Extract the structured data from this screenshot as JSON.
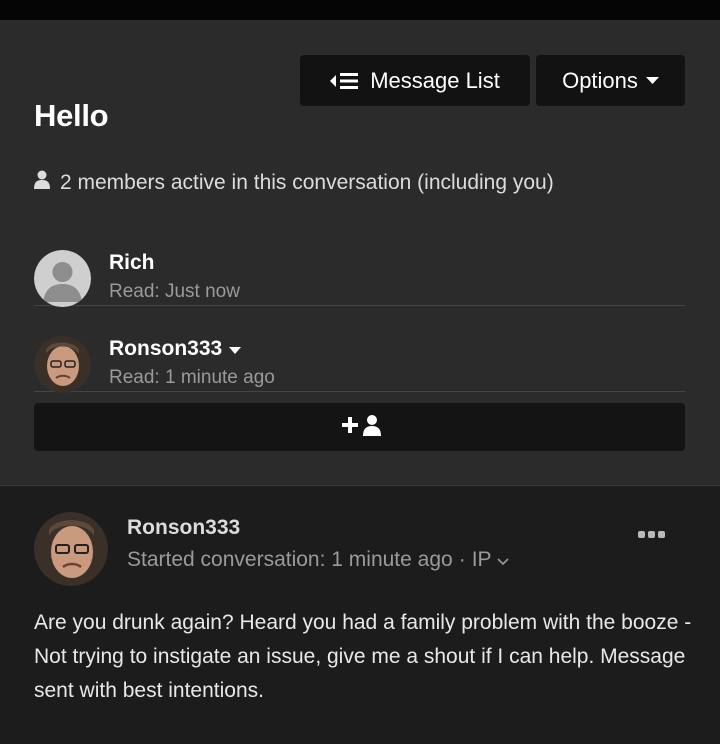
{
  "header": {
    "message_list_label": "Message List",
    "options_label": "Options",
    "title": "Hello"
  },
  "participants": {
    "summary": "2 members active in this conversation (including you)",
    "members": [
      {
        "name": "Rich",
        "read": "Read: Just now"
      },
      {
        "name": "Ronson333",
        "read": "Read: 1 minute ago"
      }
    ]
  },
  "post": {
    "author": "Ronson333",
    "meta": "Started conversation: 1 minute ago",
    "separator": "·",
    "ip_label": "IP",
    "body": "Are you drunk again? Heard you had a family problem with the booze -Not trying to instigate an issue, give me a shout if I can help. Message sent with best intentions."
  },
  "icons": {
    "message_list": "list-arrow-icon",
    "options": "caret-down-icon",
    "members": "user-icon",
    "invite": "add-user-icon",
    "more": "ellipsis-icon"
  },
  "colors": {
    "background": "#1c1c1c",
    "panel": "#2b2b2b",
    "button": "#121212",
    "muted_text": "#9a9a9a"
  }
}
